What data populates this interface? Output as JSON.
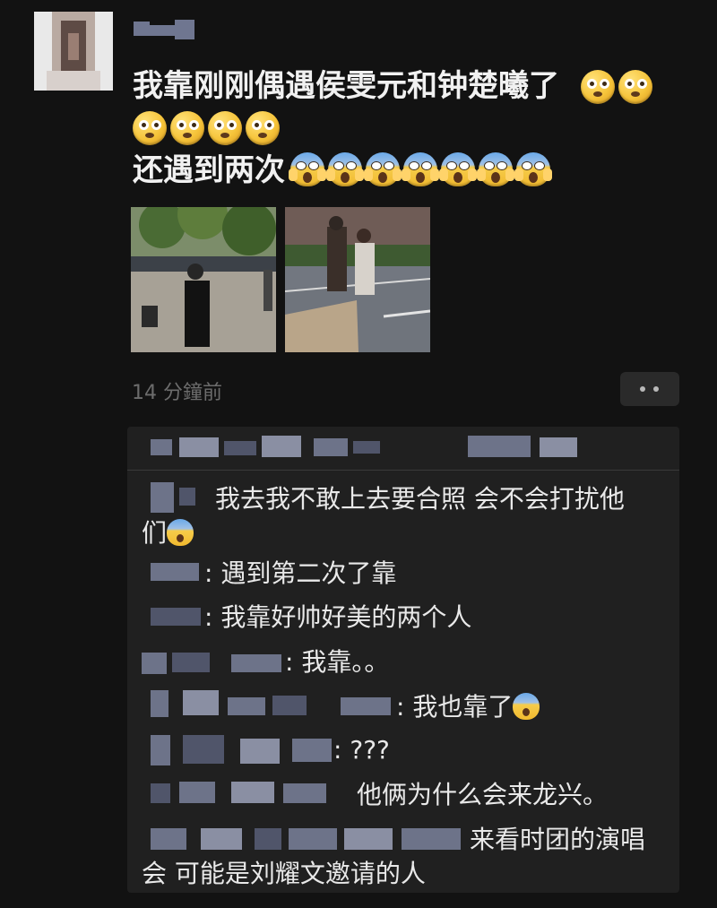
{
  "post": {
    "line1": "我靠刚刚偶遇侯雯元和钟楚曦了",
    "line2": "还遇到两次",
    "timestamp": "14 分鐘前"
  },
  "comments": [
    {
      "text": "我去我不敢上去要合照 会不会打扰他"
    },
    {
      "text": "们"
    },
    {
      "text": ": 遇到第二次了靠"
    },
    {
      "text": ": 我靠好帅好美的两个人"
    },
    {
      "text": ": 我靠。。"
    },
    {
      "text": ": 我也靠了"
    },
    {
      "text": ": ???"
    },
    {
      "text": "他俩为什么会来龙兴。"
    },
    {
      "text": "来看时团的演唱"
    },
    {
      "text": "会 可能是刘耀文邀请的人"
    }
  ],
  "icons": {
    "more": "more-dots-icon",
    "flushed": "flushed-face-icon",
    "scream": "screaming-face-icon"
  },
  "colors": {
    "background": "#121212",
    "comment_panel": "#202020",
    "timestamp": "#6c6c6c"
  }
}
